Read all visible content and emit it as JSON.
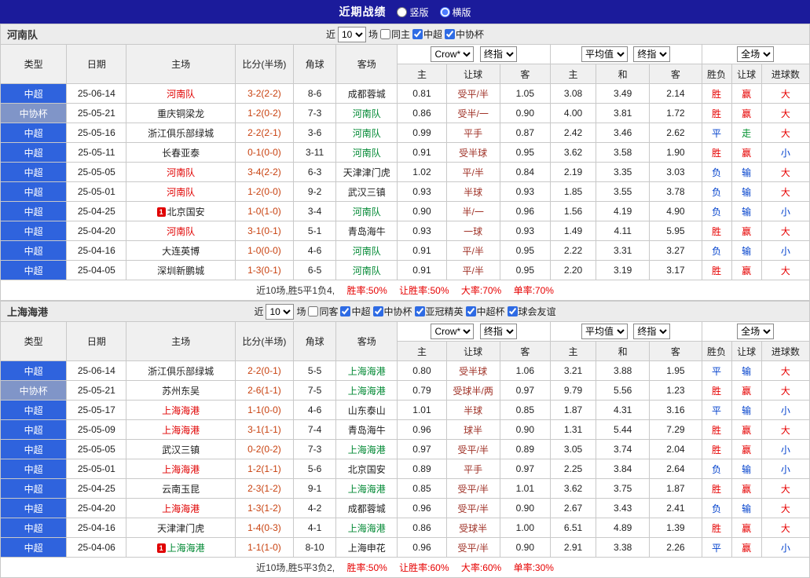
{
  "topbar": {
    "title": "近期战绩",
    "layout_options": [
      {
        "label": "竖版",
        "selected": false
      },
      {
        "label": "横版",
        "selected": true
      }
    ]
  },
  "columns": {
    "type": "类型",
    "date": "日期",
    "home": "主场",
    "score": "比分(半场)",
    "corner": "角球",
    "away": "客场",
    "odds_home": "主",
    "odds_handicap": "让球",
    "odds_away": "客",
    "euro_home": "主",
    "euro_draw": "和",
    "euro_away": "客",
    "result_wdl": "胜负",
    "result_handicap": "让球",
    "result_goals": "进球数"
  },
  "selects": {
    "company": "Crow*",
    "company_period": "终指",
    "average": "平均值",
    "average_period": "终指",
    "fulltime": "全场"
  },
  "sections": [
    {
      "team": "河南队",
      "filter": {
        "near": "近",
        "count": "10",
        "unit": "场",
        "checkboxes": [
          {
            "label": "同主",
            "checked": false
          },
          {
            "label": "中超",
            "checked": true
          },
          {
            "label": "中协杯",
            "checked": true
          }
        ]
      },
      "rows": [
        {
          "league": "中超",
          "league_type": "csl",
          "date": "25-06-14",
          "home": "河南队",
          "home_color": "red",
          "home_badge": "",
          "score": "3-2(2-2)",
          "corner": "8-6",
          "away": "成都蓉城",
          "away_color": "",
          "asia": [
            "0.81",
            "受平/半",
            "1.05"
          ],
          "euro": [
            "3.08",
            "3.49",
            "2.14"
          ],
          "results": [
            {
              "t": "胜",
              "c": "red"
            },
            {
              "t": "赢",
              "c": "red"
            },
            {
              "t": "大",
              "c": "red"
            }
          ]
        },
        {
          "league": "中协杯",
          "league_type": "cup",
          "date": "25-05-21",
          "home": "重庆铜梁龙",
          "home_color": "",
          "home_badge": "",
          "score": "1-2(0-2)",
          "corner": "7-3",
          "away": "河南队",
          "away_color": "green",
          "asia": [
            "0.86",
            "受半/一",
            "0.90"
          ],
          "euro": [
            "4.00",
            "3.81",
            "1.72"
          ],
          "results": [
            {
              "t": "胜",
              "c": "red"
            },
            {
              "t": "赢",
              "c": "red"
            },
            {
              "t": "大",
              "c": "red"
            }
          ]
        },
        {
          "league": "中超",
          "league_type": "csl",
          "date": "25-05-16",
          "home": "浙江俱乐部绿城",
          "home_color": "",
          "home_badge": "",
          "score": "2-2(2-1)",
          "corner": "3-6",
          "away": "河南队",
          "away_color": "green",
          "asia": [
            "0.99",
            "平手",
            "0.87"
          ],
          "euro": [
            "2.42",
            "3.46",
            "2.62"
          ],
          "results": [
            {
              "t": "平",
              "c": "blue"
            },
            {
              "t": "走",
              "c": "green"
            },
            {
              "t": "大",
              "c": "red"
            }
          ]
        },
        {
          "league": "中超",
          "league_type": "csl",
          "date": "25-05-11",
          "home": "长春亚泰",
          "home_color": "",
          "home_badge": "",
          "score": "0-1(0-0)",
          "corner": "3-11",
          "away": "河南队",
          "away_color": "green",
          "asia": [
            "0.91",
            "受半球",
            "0.95"
          ],
          "euro": [
            "3.62",
            "3.58",
            "1.90"
          ],
          "results": [
            {
              "t": "胜",
              "c": "red"
            },
            {
              "t": "赢",
              "c": "red"
            },
            {
              "t": "小",
              "c": "blue"
            }
          ]
        },
        {
          "league": "中超",
          "league_type": "csl",
          "date": "25-05-05",
          "home": "河南队",
          "home_color": "red",
          "home_badge": "",
          "score": "3-4(2-2)",
          "corner": "6-3",
          "away": "天津津门虎",
          "away_color": "",
          "asia": [
            "1.02",
            "平/半",
            "0.84"
          ],
          "euro": [
            "2.19",
            "3.35",
            "3.03"
          ],
          "results": [
            {
              "t": "负",
              "c": "blue"
            },
            {
              "t": "输",
              "c": "blue"
            },
            {
              "t": "大",
              "c": "red"
            }
          ]
        },
        {
          "league": "中超",
          "league_type": "csl",
          "date": "25-05-01",
          "home": "河南队",
          "home_color": "red",
          "home_badge": "",
          "score": "1-2(0-0)",
          "corner": "9-2",
          "away": "武汉三镇",
          "away_color": "",
          "asia": [
            "0.93",
            "半球",
            "0.93"
          ],
          "euro": [
            "1.85",
            "3.55",
            "3.78"
          ],
          "results": [
            {
              "t": "负",
              "c": "blue"
            },
            {
              "t": "输",
              "c": "blue"
            },
            {
              "t": "大",
              "c": "red"
            }
          ]
        },
        {
          "league": "中超",
          "league_type": "csl",
          "date": "25-04-25",
          "home": "北京国安",
          "home_color": "",
          "home_badge": "1",
          "score": "1-0(1-0)",
          "corner": "3-4",
          "away": "河南队",
          "away_color": "green",
          "asia": [
            "0.90",
            "半/一",
            "0.96"
          ],
          "euro": [
            "1.56",
            "4.19",
            "4.90"
          ],
          "results": [
            {
              "t": "负",
              "c": "blue"
            },
            {
              "t": "输",
              "c": "blue"
            },
            {
              "t": "小",
              "c": "blue"
            }
          ]
        },
        {
          "league": "中超",
          "league_type": "csl",
          "date": "25-04-20",
          "home": "河南队",
          "home_color": "red",
          "home_badge": "",
          "score": "3-1(0-1)",
          "corner": "5-1",
          "away": "青岛海牛",
          "away_color": "",
          "asia": [
            "0.93",
            "一球",
            "0.93"
          ],
          "euro": [
            "1.49",
            "4.11",
            "5.95"
          ],
          "results": [
            {
              "t": "胜",
              "c": "red"
            },
            {
              "t": "赢",
              "c": "red"
            },
            {
              "t": "大",
              "c": "red"
            }
          ]
        },
        {
          "league": "中超",
          "league_type": "csl",
          "date": "25-04-16",
          "home": "大连英博",
          "home_color": "",
          "home_badge": "",
          "score": "1-0(0-0)",
          "corner": "4-6",
          "away": "河南队",
          "away_color": "green",
          "asia": [
            "0.91",
            "平/半",
            "0.95"
          ],
          "euro": [
            "2.22",
            "3.31",
            "3.27"
          ],
          "results": [
            {
              "t": "负",
              "c": "blue"
            },
            {
              "t": "输",
              "c": "blue"
            },
            {
              "t": "小",
              "c": "blue"
            }
          ]
        },
        {
          "league": "中超",
          "league_type": "csl",
          "date": "25-04-05",
          "home": "深圳新鹏城",
          "home_color": "",
          "home_badge": "",
          "score": "1-3(0-1)",
          "corner": "6-5",
          "away": "河南队",
          "away_color": "green",
          "asia": [
            "0.91",
            "平/半",
            "0.95"
          ],
          "euro": [
            "2.20",
            "3.19",
            "3.17"
          ],
          "results": [
            {
              "t": "胜",
              "c": "red"
            },
            {
              "t": "赢",
              "c": "red"
            },
            {
              "t": "大",
              "c": "red"
            }
          ]
        }
      ],
      "summary": {
        "prefix": "近10场,胜5平1负4,",
        "stats": [
          "胜率:50%",
          "让胜率:50%",
          "大率:70%",
          "单率:70%"
        ]
      }
    },
    {
      "team": "上海海港",
      "filter": {
        "near": "近",
        "count": "10",
        "unit": "场",
        "checkboxes": [
          {
            "label": "同客",
            "checked": false
          },
          {
            "label": "中超",
            "checked": true
          },
          {
            "label": "中协杯",
            "checked": true
          },
          {
            "label": "亚冠精英",
            "checked": true
          },
          {
            "label": "中超杯",
            "checked": true
          },
          {
            "label": "球会友谊",
            "checked": true
          }
        ]
      },
      "rows": [
        {
          "league": "中超",
          "league_type": "csl",
          "date": "25-06-14",
          "home": "浙江俱乐部绿城",
          "home_color": "",
          "home_badge": "",
          "score": "2-2(0-1)",
          "corner": "5-5",
          "away": "上海海港",
          "away_color": "green",
          "asia": [
            "0.80",
            "受半球",
            "1.06"
          ],
          "euro": [
            "3.21",
            "3.88",
            "1.95"
          ],
          "results": [
            {
              "t": "平",
              "c": "blue"
            },
            {
              "t": "输",
              "c": "blue"
            },
            {
              "t": "大",
              "c": "red"
            }
          ]
        },
        {
          "league": "中协杯",
          "league_type": "cup",
          "date": "25-05-21",
          "home": "苏州东吴",
          "home_color": "",
          "home_badge": "",
          "score": "2-6(1-1)",
          "corner": "7-5",
          "away": "上海海港",
          "away_color": "green",
          "asia": [
            "0.79",
            "受球半/两",
            "0.97"
          ],
          "euro": [
            "9.79",
            "5.56",
            "1.23"
          ],
          "results": [
            {
              "t": "胜",
              "c": "red"
            },
            {
              "t": "赢",
              "c": "red"
            },
            {
              "t": "大",
              "c": "red"
            }
          ]
        },
        {
          "league": "中超",
          "league_type": "csl",
          "date": "25-05-17",
          "home": "上海海港",
          "home_color": "red",
          "home_badge": "",
          "score": "1-1(0-0)",
          "corner": "4-6",
          "away": "山东泰山",
          "away_color": "",
          "asia": [
            "1.01",
            "半球",
            "0.85"
          ],
          "euro": [
            "1.87",
            "4.31",
            "3.16"
          ],
          "results": [
            {
              "t": "平",
              "c": "blue"
            },
            {
              "t": "输",
              "c": "blue"
            },
            {
              "t": "小",
              "c": "blue"
            }
          ]
        },
        {
          "league": "中超",
          "league_type": "csl",
          "date": "25-05-09",
          "home": "上海海港",
          "home_color": "red",
          "home_badge": "",
          "score": "3-1(1-1)",
          "corner": "7-4",
          "away": "青岛海牛",
          "away_color": "",
          "asia": [
            "0.96",
            "球半",
            "0.90"
          ],
          "euro": [
            "1.31",
            "5.44",
            "7.29"
          ],
          "results": [
            {
              "t": "胜",
              "c": "red"
            },
            {
              "t": "赢",
              "c": "red"
            },
            {
              "t": "大",
              "c": "red"
            }
          ]
        },
        {
          "league": "中超",
          "league_type": "csl",
          "date": "25-05-05",
          "home": "武汉三镇",
          "home_color": "",
          "home_badge": "",
          "score": "0-2(0-2)",
          "corner": "7-3",
          "away": "上海海港",
          "away_color": "green",
          "asia": [
            "0.97",
            "受平/半",
            "0.89"
          ],
          "euro": [
            "3.05",
            "3.74",
            "2.04"
          ],
          "results": [
            {
              "t": "胜",
              "c": "red"
            },
            {
              "t": "赢",
              "c": "red"
            },
            {
              "t": "小",
              "c": "blue"
            }
          ]
        },
        {
          "league": "中超",
          "league_type": "csl",
          "date": "25-05-01",
          "home": "上海海港",
          "home_color": "red",
          "home_badge": "",
          "score": "1-2(1-1)",
          "corner": "5-6",
          "away": "北京国安",
          "away_color": "",
          "asia": [
            "0.89",
            "平手",
            "0.97"
          ],
          "euro": [
            "2.25",
            "3.84",
            "2.64"
          ],
          "results": [
            {
              "t": "负",
              "c": "blue"
            },
            {
              "t": "输",
              "c": "blue"
            },
            {
              "t": "小",
              "c": "blue"
            }
          ]
        },
        {
          "league": "中超",
          "league_type": "csl",
          "date": "25-04-25",
          "home": "云南玉昆",
          "home_color": "",
          "home_badge": "",
          "score": "2-3(1-2)",
          "corner": "9-1",
          "away": "上海海港",
          "away_color": "green",
          "asia": [
            "0.85",
            "受平/半",
            "1.01"
          ],
          "euro": [
            "3.62",
            "3.75",
            "1.87"
          ],
          "results": [
            {
              "t": "胜",
              "c": "red"
            },
            {
              "t": "赢",
              "c": "red"
            },
            {
              "t": "大",
              "c": "red"
            }
          ]
        },
        {
          "league": "中超",
          "league_type": "csl",
          "date": "25-04-20",
          "home": "上海海港",
          "home_color": "red",
          "home_badge": "",
          "score": "1-3(1-2)",
          "corner": "4-2",
          "away": "成都蓉城",
          "away_color": "",
          "asia": [
            "0.96",
            "受平/半",
            "0.90"
          ],
          "euro": [
            "2.67",
            "3.43",
            "2.41"
          ],
          "results": [
            {
              "t": "负",
              "c": "blue"
            },
            {
              "t": "输",
              "c": "blue"
            },
            {
              "t": "大",
              "c": "red"
            }
          ]
        },
        {
          "league": "中超",
          "league_type": "csl",
          "date": "25-04-16",
          "home": "天津津门虎",
          "home_color": "",
          "home_badge": "",
          "score": "1-4(0-3)",
          "corner": "4-1",
          "away": "上海海港",
          "away_color": "green",
          "asia": [
            "0.86",
            "受球半",
            "1.00"
          ],
          "euro": [
            "6.51",
            "4.89",
            "1.39"
          ],
          "results": [
            {
              "t": "胜",
              "c": "red"
            },
            {
              "t": "赢",
              "c": "red"
            },
            {
              "t": "大",
              "c": "red"
            }
          ]
        },
        {
          "league": "中超",
          "league_type": "csl",
          "date": "25-04-06",
          "home": "上海海港",
          "home_color": "green",
          "home_badge": "1",
          "score": "1-1(1-0)",
          "corner": "8-10",
          "away": "上海申花",
          "away_color": "",
          "asia": [
            "0.96",
            "受平/半",
            "0.90"
          ],
          "euro": [
            "2.91",
            "3.38",
            "2.26"
          ],
          "results": [
            {
              "t": "平",
              "c": "blue"
            },
            {
              "t": "赢",
              "c": "red"
            },
            {
              "t": "小",
              "c": "blue"
            }
          ]
        }
      ],
      "summary": {
        "prefix": "近10场,胜5平3负2,",
        "stats": [
          "胜率:50%",
          "让胜率:60%",
          "大率:60%",
          "单率:30%"
        ]
      }
    }
  ]
}
